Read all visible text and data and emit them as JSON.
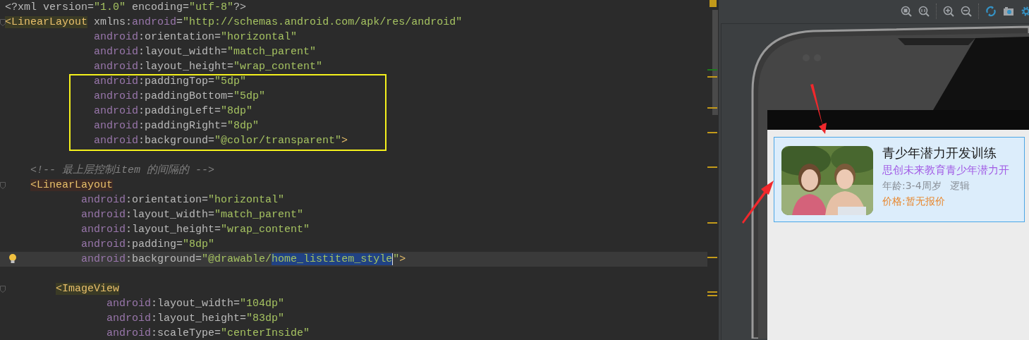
{
  "editor": {
    "blocks": [
      {
        "boxed": false,
        "lines": [
          {
            "current": false,
            "tokens": [
              {
                "kind": "plain",
                "text": "<?xml version="
              },
              {
                "kind": "str",
                "text": "\"1.0\""
              },
              {
                "kind": "plain",
                "text": " encoding="
              },
              {
                "kind": "str",
                "text": "\"utf-8\""
              },
              {
                "kind": "plain",
                "text": "?>"
              }
            ]
          },
          {
            "current": false,
            "fold": true,
            "tokens": [
              {
                "kind": "tag_usage",
                "text": "<LinearLayout"
              },
              {
                "kind": "plain",
                "text": " xmlns:"
              },
              {
                "kind": "ns",
                "text": "android"
              },
              {
                "kind": "plain",
                "text": "="
              },
              {
                "kind": "str",
                "text": "\"http://schemas.android.com/apk/res/android\""
              }
            ]
          },
          {
            "current": false,
            "tokens": [
              {
                "kind": "ns",
                "text": "              android"
              },
              {
                "kind": "plain",
                "text": ":orientation="
              },
              {
                "kind": "str",
                "text": "\"horizontal\""
              }
            ]
          },
          {
            "current": false,
            "tokens": [
              {
                "kind": "ns",
                "text": "              android"
              },
              {
                "kind": "plain",
                "text": ":layout_width="
              },
              {
                "kind": "str",
                "text": "\"match_parent\""
              }
            ]
          },
          {
            "current": false,
            "tokens": [
              {
                "kind": "ns",
                "text": "              android"
              },
              {
                "kind": "plain",
                "text": ":layout_height="
              },
              {
                "kind": "str",
                "text": "\"wrap_content\""
              }
            ]
          }
        ]
      },
      {
        "boxed": true,
        "lines": [
          {
            "current": false,
            "tokens": [
              {
                "kind": "ns",
                "text": "              android"
              },
              {
                "kind": "plain",
                "text": ":paddingTop="
              },
              {
                "kind": "str",
                "text": "\"5dp\""
              }
            ]
          },
          {
            "current": false,
            "tokens": [
              {
                "kind": "ns",
                "text": "              android"
              },
              {
                "kind": "plain",
                "text": ":paddingBottom="
              },
              {
                "kind": "str",
                "text": "\"5dp\""
              }
            ]
          },
          {
            "current": false,
            "tokens": [
              {
                "kind": "ns",
                "text": "              android"
              },
              {
                "kind": "plain",
                "text": ":paddingLeft="
              },
              {
                "kind": "str",
                "text": "\"8dp\""
              }
            ]
          },
          {
            "current": false,
            "tokens": [
              {
                "kind": "ns",
                "text": "              android"
              },
              {
                "kind": "plain",
                "text": ":paddingRight="
              },
              {
                "kind": "str",
                "text": "\"8dp\""
              }
            ]
          },
          {
            "current": false,
            "tokens": [
              {
                "kind": "ns",
                "text": "              android"
              },
              {
                "kind": "plain",
                "text": ":background="
              },
              {
                "kind": "str",
                "text": "\"@color/transparent\""
              },
              {
                "kind": "tag",
                "text": ">"
              }
            ]
          }
        ]
      },
      {
        "boxed": false,
        "lines": [
          {
            "current": false
          },
          {
            "current": false,
            "tokens": [
              {
                "kind": "comment",
                "text": "    <!-- 最上层控制item 的间隔的 -->"
              }
            ]
          },
          {
            "current": false,
            "fold": true,
            "tokens": [
              {
                "kind": "tag_match",
                "text": "    <LinearLayout"
              }
            ]
          },
          {
            "current": false,
            "tokens": [
              {
                "kind": "ns",
                "text": "            android"
              },
              {
                "kind": "plain",
                "text": ":orientation="
              },
              {
                "kind": "str",
                "text": "\"horizontal\""
              }
            ]
          },
          {
            "current": false,
            "tokens": [
              {
                "kind": "ns",
                "text": "            android"
              },
              {
                "kind": "plain",
                "text": ":layout_width="
              },
              {
                "kind": "str",
                "text": "\"match_parent\""
              }
            ]
          },
          {
            "current": false,
            "tokens": [
              {
                "kind": "ns",
                "text": "            android"
              },
              {
                "kind": "plain",
                "text": ":layout_height="
              },
              {
                "kind": "str",
                "text": "\"wrap_content\""
              }
            ]
          },
          {
            "current": false,
            "tokens": [
              {
                "kind": "ns",
                "text": "            android"
              },
              {
                "kind": "plain",
                "text": ":padding="
              },
              {
                "kind": "str",
                "text": "\"8dp\""
              }
            ]
          },
          {
            "current": true,
            "bulb": true,
            "tokens": [
              {
                "kind": "ns",
                "text": "            android"
              },
              {
                "kind": "plain",
                "text": ":background="
              },
              {
                "kind": "str",
                "text": "\"@drawable/"
              },
              {
                "kind": "sel",
                "text": "home_listitem_style"
              },
              {
                "kind": "str",
                "text": "\""
              },
              {
                "kind": "tag",
                "text": ">"
              }
            ]
          },
          {
            "current": false
          },
          {
            "current": false,
            "fold": true,
            "tokens": [
              {
                "kind": "tag_usage",
                "text": "        <ImageView"
              }
            ]
          },
          {
            "current": false,
            "tokens": [
              {
                "kind": "ns",
                "text": "                android"
              },
              {
                "kind": "plain",
                "text": ":layout_width="
              },
              {
                "kind": "str",
                "text": "\"104dp\""
              }
            ]
          },
          {
            "current": false,
            "tokens": [
              {
                "kind": "ns",
                "text": "                android"
              },
              {
                "kind": "plain",
                "text": ":layout_height="
              },
              {
                "kind": "str",
                "text": "\"83dp\""
              }
            ]
          },
          {
            "current": false,
            "tokens": [
              {
                "kind": "ns",
                "text": "                android"
              },
              {
                "kind": "plain",
                "text": ":scaleType="
              },
              {
                "kind": "str",
                "text": "\"centerInside\""
              }
            ]
          }
        ]
      }
    ]
  },
  "preview": {
    "card": {
      "title": "青少年潜力开发训练",
      "subtitle": "思创未来教育青少年潜力开",
      "age": "年龄:3-4周岁",
      "tag": "逻辑",
      "price": "价格:暂无报价"
    }
  }
}
